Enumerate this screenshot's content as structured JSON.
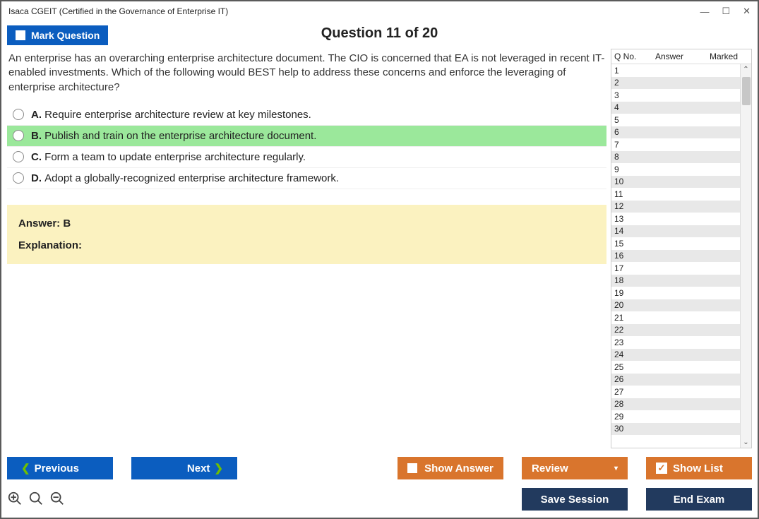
{
  "window": {
    "title": "Isaca CGEIT (Certified in the Governance of Enterprise IT)"
  },
  "header": {
    "mark_label": "Mark Question",
    "title": "Question 11 of 20"
  },
  "question": {
    "text": "An enterprise has an overarching enterprise architecture document. The CIO is concerned that EA is not leveraged in recent IT-enabled investments. Which of the following would BEST help to address these concerns and enforce the leveraging of enterprise architecture?",
    "choices": [
      {
        "letter": "A.",
        "text": "Require enterprise architecture review at key milestones.",
        "selected": false
      },
      {
        "letter": "B.",
        "text": "Publish and train on the enterprise architecture document.",
        "selected": true
      },
      {
        "letter": "C.",
        "text": "Form a team to update enterprise architecture regularly.",
        "selected": false
      },
      {
        "letter": "D.",
        "text": "Adopt a globally-recognized enterprise architecture framework.",
        "selected": false
      }
    ]
  },
  "answer_box": {
    "answer": "Answer: B",
    "exp_label": "Explanation:"
  },
  "side": {
    "col1": "Q No.",
    "col2": "Answer",
    "col3": "Marked",
    "rows": [
      1,
      2,
      3,
      4,
      5,
      6,
      7,
      8,
      9,
      10,
      11,
      12,
      13,
      14,
      15,
      16,
      17,
      18,
      19,
      20,
      21,
      22,
      23,
      24,
      25,
      26,
      27,
      28,
      29,
      30
    ]
  },
  "footer": {
    "previous": "Previous",
    "next": "Next",
    "show_answer": "Show Answer",
    "review": "Review",
    "show_list": "Show List",
    "save_session": "Save Session",
    "end_exam": "End Exam"
  }
}
